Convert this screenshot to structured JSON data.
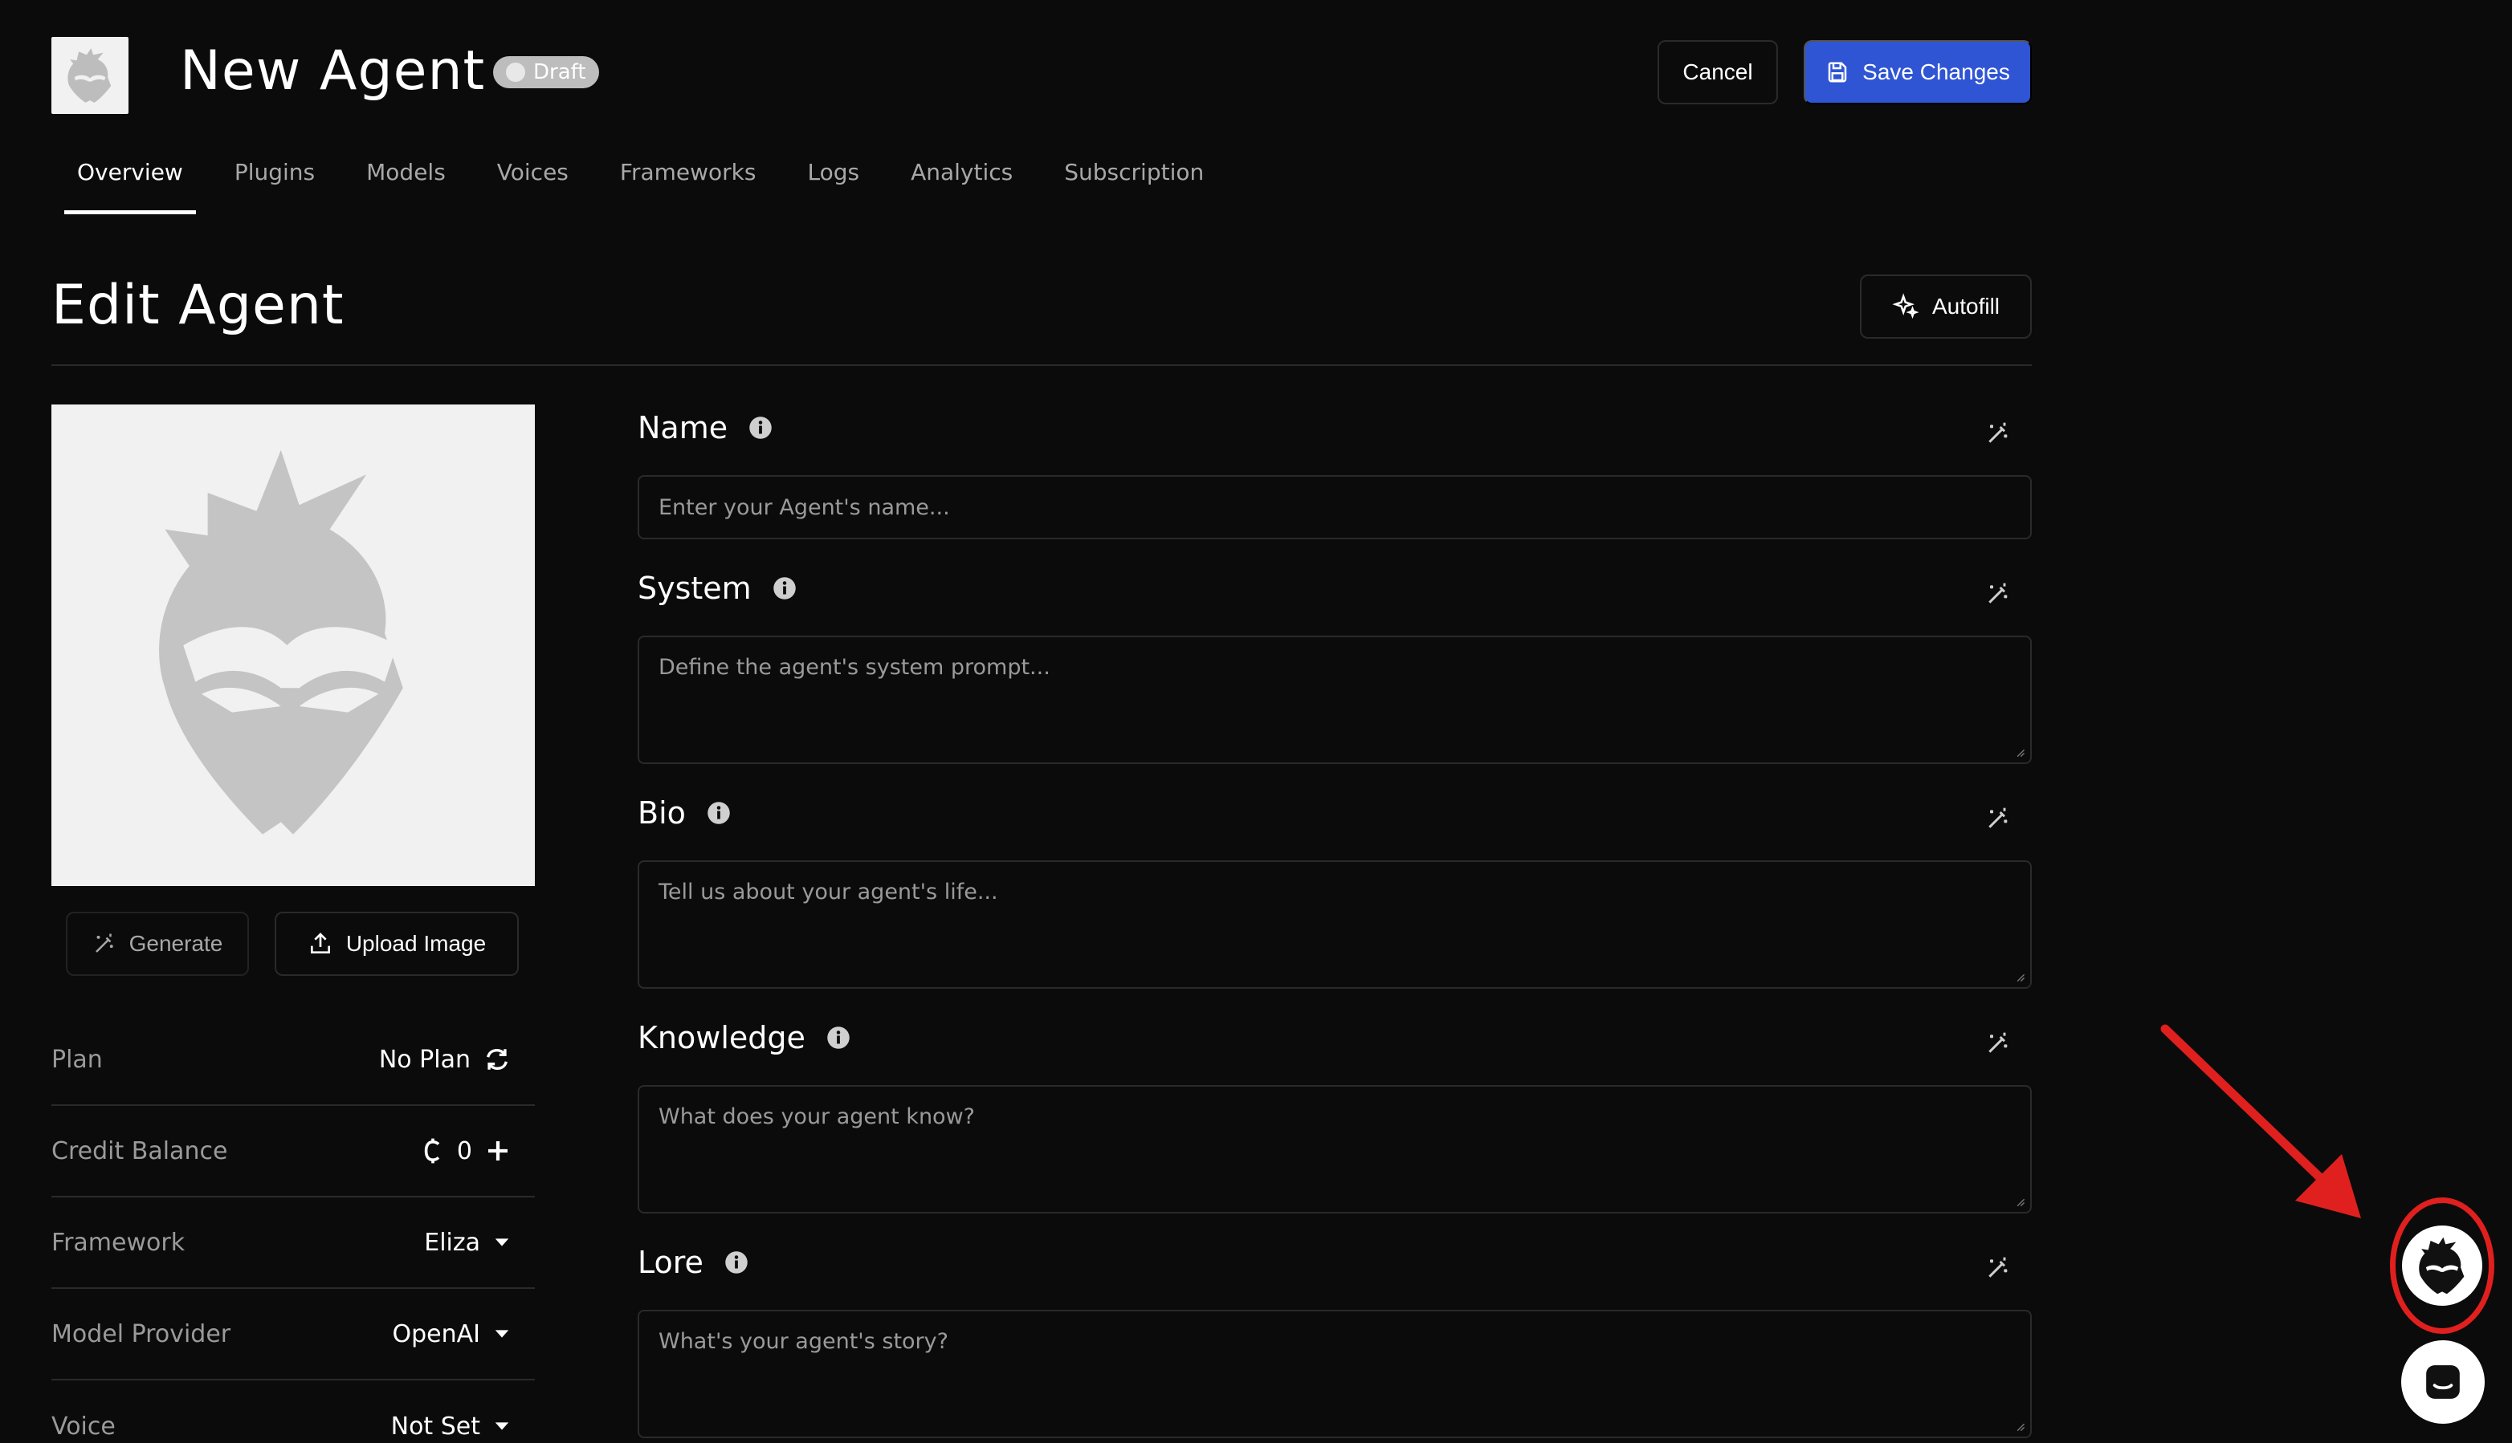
{
  "header": {
    "agent_name": "New Agent",
    "status_badge": "Draft",
    "cancel_label": "Cancel",
    "save_label": "Save Changes"
  },
  "tabs": [
    {
      "label": "Overview",
      "active": true
    },
    {
      "label": "Plugins"
    },
    {
      "label": "Models"
    },
    {
      "label": "Voices"
    },
    {
      "label": "Frameworks"
    },
    {
      "label": "Logs"
    },
    {
      "label": "Analytics"
    },
    {
      "label": "Subscription"
    }
  ],
  "edit": {
    "title": "Edit Agent",
    "autofill_label": "Autofill"
  },
  "image_panel": {
    "generate_label": "Generate",
    "upload_label": "Upload Image"
  },
  "info": {
    "plan": {
      "label": "Plan",
      "value": "No Plan"
    },
    "credit_balance": {
      "label": "Credit Balance",
      "value": "0"
    },
    "framework": {
      "label": "Framework",
      "value": "Eliza"
    },
    "model_provider": {
      "label": "Model Provider",
      "value": "OpenAI"
    },
    "voice": {
      "label": "Voice",
      "value": "Not Set"
    }
  },
  "form": {
    "name": {
      "label": "Name",
      "placeholder": "Enter your Agent's name..."
    },
    "system": {
      "label": "System",
      "placeholder": "Define the agent's system prompt..."
    },
    "bio": {
      "label": "Bio",
      "placeholder": "Tell us about your agent's life..."
    },
    "knowledge": {
      "label": "Knowledge",
      "placeholder": "What does your agent know?"
    },
    "lore": {
      "label": "Lore",
      "placeholder": "What's your agent's story?"
    }
  },
  "colors": {
    "background": "#0b0b0b",
    "primary": "#2f55d4",
    "border": "#2a2a2a",
    "muted_text": "#9a9a9a",
    "highlight_annotation": "#e0201e"
  }
}
